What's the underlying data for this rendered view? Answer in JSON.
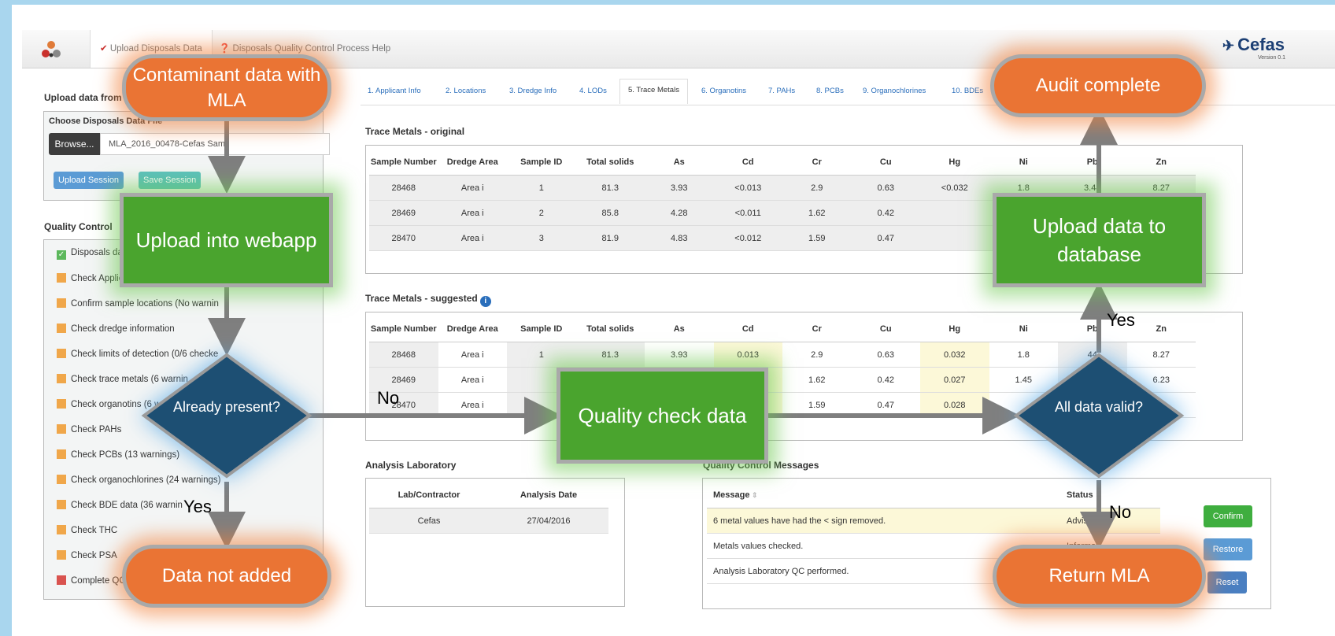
{
  "nav": {
    "tab_upload": "Upload Disposals Data",
    "tab_help": "Disposals Quality Control Process Help",
    "brand": "Cefas",
    "version": "Version 0.1"
  },
  "upload": {
    "title": "Upload data from",
    "choose_label": "Choose Disposals Data File",
    "browse": "Browse...",
    "file_name": "MLA_2016_00478-Cefas Sam",
    "upload_session": "Upload Session",
    "save_session": "Save Session"
  },
  "qc": {
    "title": "Quality Control",
    "items": [
      {
        "label": "Disposals da",
        "status": "green"
      },
      {
        "label": "Check Applic",
        "status": "orange"
      },
      {
        "label": "Confirm sample locations (No warnin",
        "status": "orange"
      },
      {
        "label": "Check dredge information",
        "status": "orange"
      },
      {
        "label": "Check limits of detection (0/6 checke",
        "status": "orange"
      },
      {
        "label": "Check trace metals (6 warnin",
        "status": "orange"
      },
      {
        "label": "Check organotins (6 w",
        "status": "orange"
      },
      {
        "label": "Check PAHs",
        "status": "orange"
      },
      {
        "label": "Check PCBs (13 warnings)",
        "status": "orange"
      },
      {
        "label": "Check organochlorines (24 warnings)",
        "status": "orange"
      },
      {
        "label": "Check BDE data (36 warnin",
        "status": "orange"
      },
      {
        "label": "Check THC",
        "status": "orange"
      },
      {
        "label": "Check PSA",
        "status": "orange"
      },
      {
        "label": "Complete QC",
        "status": "red"
      }
    ]
  },
  "subtabs": [
    "1. Applicant Info",
    "2. Locations",
    "3. Dredge Info",
    "4. LODs",
    "5. Trace Metals",
    "6. Organotins",
    "7. PAHs",
    "8. PCBs",
    "9. Organochlorines",
    "10. BDEs"
  ],
  "original": {
    "title": "Trace Metals - original",
    "headers": [
      "Sample Number",
      "Dredge Area",
      "Sample ID",
      "Total solids",
      "As",
      "Cd",
      "Cr",
      "Cu",
      "Hg",
      "Ni",
      "Pb",
      "Zn"
    ],
    "rows": [
      [
        "28468",
        "Area i",
        "1",
        "81.3",
        "3.93",
        "<0.013",
        "2.9",
        "0.63",
        "<0.032",
        "1.8",
        "3.44",
        "8.27"
      ],
      [
        "28469",
        "Area i",
        "2",
        "85.8",
        "4.28",
        "<0.011",
        "1.62",
        "0.42",
        "",
        "",
        "",
        ""
      ],
      [
        "28470",
        "Area i",
        "3",
        "81.9",
        "4.83",
        "<0.012",
        "1.59",
        "0.47",
        "",
        "",
        "",
        ""
      ]
    ]
  },
  "suggested": {
    "title": "Trace Metals - suggested",
    "info": "i",
    "headers": [
      "Sample Number",
      "Dredge Area",
      "Sample ID",
      "Total solids",
      "As",
      "Cd",
      "Cr",
      "Cu",
      "Hg",
      "Ni",
      "Pb",
      "Zn"
    ],
    "rows": [
      [
        "28468",
        "Area i",
        "1",
        "81.3",
        "3.93",
        "0.013",
        "2.9",
        "0.63",
        "0.032",
        "1.8",
        "44",
        "8.27"
      ],
      [
        "28469",
        "Area i",
        "",
        "",
        "8",
        "0.011",
        "1.62",
        "0.42",
        "0.027",
        "1.45",
        "",
        "6.23"
      ],
      [
        "28470",
        "Area i",
        "",
        "",
        "3",
        "0.012",
        "1.59",
        "0.47",
        "0.028",
        "",
        "",
        "75"
      ]
    ]
  },
  "lab": {
    "title": "Analysis Laboratory",
    "headers": [
      "Lab/Contractor",
      "Analysis Date"
    ],
    "rows": [
      [
        "Cefas",
        "27/04/2016"
      ]
    ]
  },
  "messages": {
    "title": "Quality Control Messages",
    "headers": [
      "Message",
      "Status"
    ],
    "rows": [
      [
        "6 metal values have had the < sign removed.",
        "Advisory"
      ],
      [
        "Metals values checked.",
        "Informati"
      ],
      [
        "Analysis Laboratory QC performed.",
        ""
      ]
    ],
    "confirm": "Confirm",
    "restore": "Restore",
    "reset": "Reset"
  },
  "flow": {
    "contaminant": "Contaminant data with MLA",
    "upload_webapp": "Upload into webapp",
    "already_present": "Already present?",
    "data_not_added": "Data not added",
    "quality_check": "Quality check data",
    "all_valid": "All data valid?",
    "upload_db": "Upload data to database",
    "audit": "Audit complete",
    "return_mla": "Return MLA",
    "no_left": "No",
    "yes_left": "Yes",
    "yes_right": "Yes",
    "no_right": "No"
  }
}
